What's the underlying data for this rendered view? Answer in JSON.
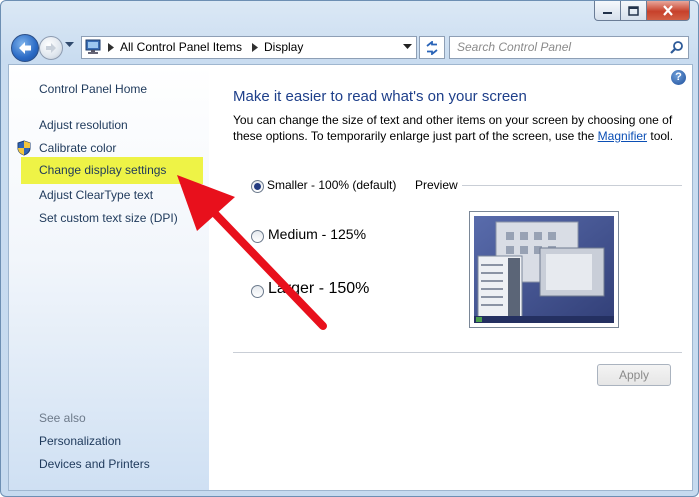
{
  "window": {
    "caption_buttons": [
      "minimize-icon",
      "maximize-icon",
      "close-icon"
    ]
  },
  "navbar": {
    "breadcrumb": [
      "All Control Panel Items",
      "Display"
    ],
    "search_placeholder": "Search Control Panel"
  },
  "sidebar": {
    "home": "Control Panel Home",
    "items": [
      {
        "label": "Adjust resolution"
      },
      {
        "label": "Calibrate color"
      },
      {
        "label": "Change display settings",
        "highlighted": true
      },
      {
        "label": "Adjust ClearType text"
      },
      {
        "label": "Set custom text size (DPI)"
      }
    ],
    "see_also_title": "See also",
    "see_also": [
      {
        "label": "Personalization"
      },
      {
        "label": "Devices and Printers"
      }
    ]
  },
  "main": {
    "help": "?",
    "heading": "Make it easier to read what's on your screen",
    "description": "You can change the size of text and other items on your screen by choosing one of these options. To temporarily enlarge just part of the screen, use the",
    "magnifier_link": "Magnifier",
    "description_tail": "tool.",
    "options": [
      {
        "label": "Smaller - 100% (default)",
        "selected": true
      },
      {
        "label": "Medium - 125%",
        "selected": false
      },
      {
        "label": "Larger - 150%",
        "selected": false
      }
    ],
    "preview_label": "Preview",
    "apply_label": "Apply",
    "apply_enabled": false
  },
  "colors": {
    "highlight": "#eef346",
    "arrow": "#e8101c",
    "link": "#1e395b",
    "heading": "#1e3f8a"
  }
}
